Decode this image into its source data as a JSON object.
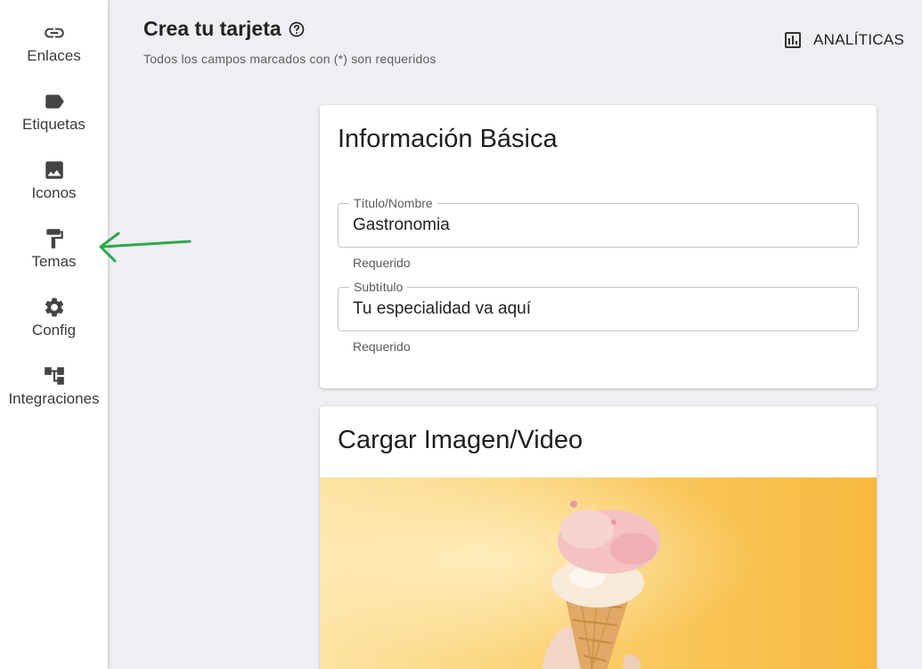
{
  "sidebar": {
    "items": [
      {
        "label": "Enlaces",
        "icon": "link-icon"
      },
      {
        "label": "Etiquetas",
        "icon": "label-icon"
      },
      {
        "label": "Iconos",
        "icon": "image-icon"
      },
      {
        "label": "Temas",
        "icon": "paint-roller-icon"
      },
      {
        "label": "Config",
        "icon": "gear-icon"
      },
      {
        "label": "Integraciones",
        "icon": "integrations-icon"
      }
    ]
  },
  "header": {
    "title": "Crea tu tarjeta",
    "subtitle": "Todos los campos marcados con (*) son requeridos",
    "analytics_label": "ANALÍTICAS"
  },
  "basic_info": {
    "title": "Información Básica",
    "title_field": {
      "label": "Título/Nombre",
      "value": "Gastronomia",
      "helper": "Requerido"
    },
    "subtitle_field": {
      "label": "Subtítulo",
      "value": "Tu especialidad va aquí",
      "helper": "Requerido"
    }
  },
  "media": {
    "title": "Cargar Imagen/Video"
  },
  "colors": {
    "background": "#eeeef3",
    "annotation_arrow": "#2aa84a"
  }
}
